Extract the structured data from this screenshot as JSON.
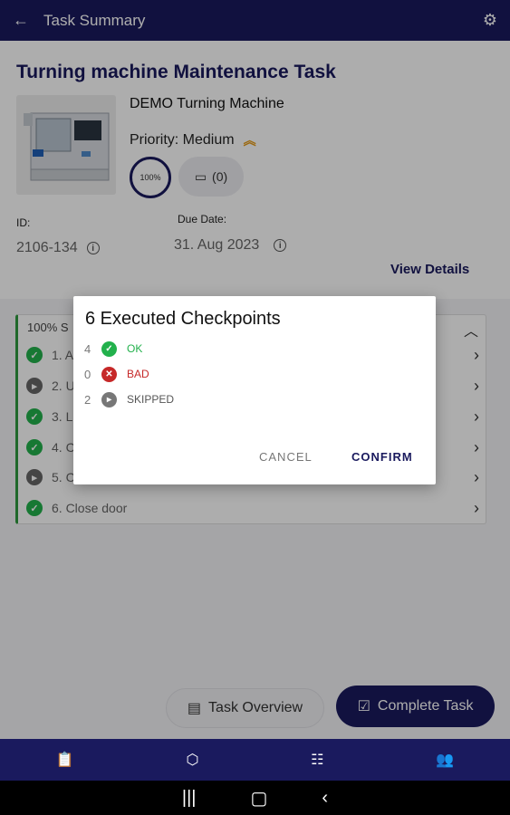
{
  "appbar": {
    "title": "Task Summary",
    "back_icon": "arrow-left-icon",
    "settings_icon": "gear-icon"
  },
  "task": {
    "title": "Turning machine Maintenance Task",
    "machine_name": "DEMO Turning Machine",
    "priority_label": "Priority: Medium",
    "priority_icon": "double-chevron-up-icon",
    "progress": "100%",
    "comment_count": "(0)",
    "id_label": "ID:",
    "id_value": "2106-134",
    "due_label": "Due Date:",
    "due_value": "31. Aug 2023",
    "view_details": "View Details"
  },
  "checkpoints": {
    "header": "100%  S",
    "items": [
      {
        "label": "1. A",
        "status": "ok"
      },
      {
        "label": "2. U",
        "status": "skipped"
      },
      {
        "label": "3. L",
        "status": "ok"
      },
      {
        "label": "4. C",
        "status": "ok"
      },
      {
        "label": "5. C",
        "status": "skipped"
      },
      {
        "label": "6. Close door",
        "status": "ok"
      }
    ]
  },
  "actions": {
    "overview": "Task Overview",
    "complete": "Complete Task"
  },
  "dialog": {
    "title": "6 Executed Checkpoints",
    "rows": [
      {
        "count": "4",
        "label": "OK",
        "color": "#22b14c"
      },
      {
        "count": "0",
        "label": "BAD",
        "color": "#c62828"
      },
      {
        "count": "2",
        "label": "SKIPPED",
        "color": "#777777"
      }
    ],
    "cancel": "CANCEL",
    "confirm": "CONFIRM"
  },
  "colors": {
    "primary": "#1a1a5e",
    "ok": "#22b14c",
    "bad": "#c62828",
    "skipped": "#777777",
    "accent": "#e59a16"
  }
}
